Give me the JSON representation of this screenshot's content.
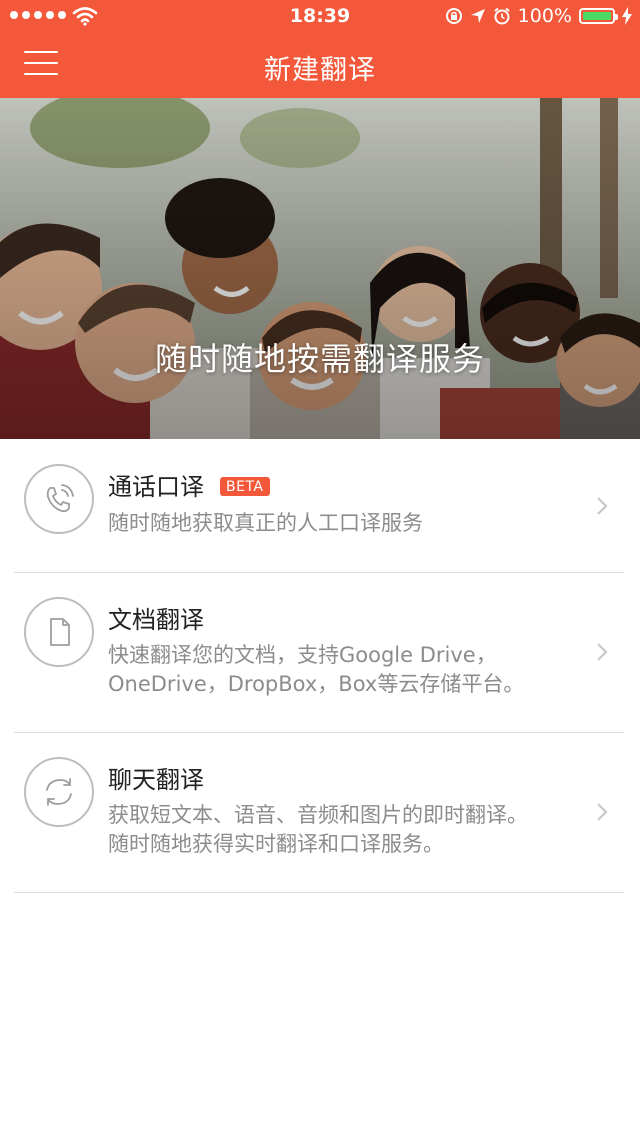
{
  "status_bar": {
    "time": "18:39",
    "battery_percent": "100%",
    "battery_level": 1.0,
    "icons": [
      "signal-dots-icon",
      "wifi-icon",
      "rotation-lock-icon",
      "location-arrow-icon",
      "alarm-icon",
      "battery-icon",
      "charging-bolt-icon"
    ]
  },
  "nav": {
    "title": "新建翻译",
    "menu_icon": "hamburger-menu-icon"
  },
  "hero": {
    "tagline": "随时随地按需翻译服务",
    "image": "group-of-smiling-friends-photo"
  },
  "services": [
    {
      "title": "通话口译",
      "badge": "BETA",
      "description": "随时随地获取真正的人工口译服务",
      "icon": "phone-call-icon"
    },
    {
      "title": "文档翻译",
      "description_line1": "快速翻译您的文档，支持Google Drive，",
      "description_line2": "OneDrive，DropBox，Box等云存储平台。",
      "icon": "document-icon"
    },
    {
      "title": "聊天翻译",
      "description_line1": "获取短文本、语音、音频和图片的即时翻译。",
      "description_line2": "随时随地获得实时翻译和口译服务。",
      "icon": "refresh-cycle-icon"
    }
  ],
  "colors": {
    "accent": "#f4583a",
    "battery_green": "#4cd964",
    "text_primary": "#222222",
    "text_secondary": "#8c8c8c",
    "divider": "#dcdcdc"
  }
}
